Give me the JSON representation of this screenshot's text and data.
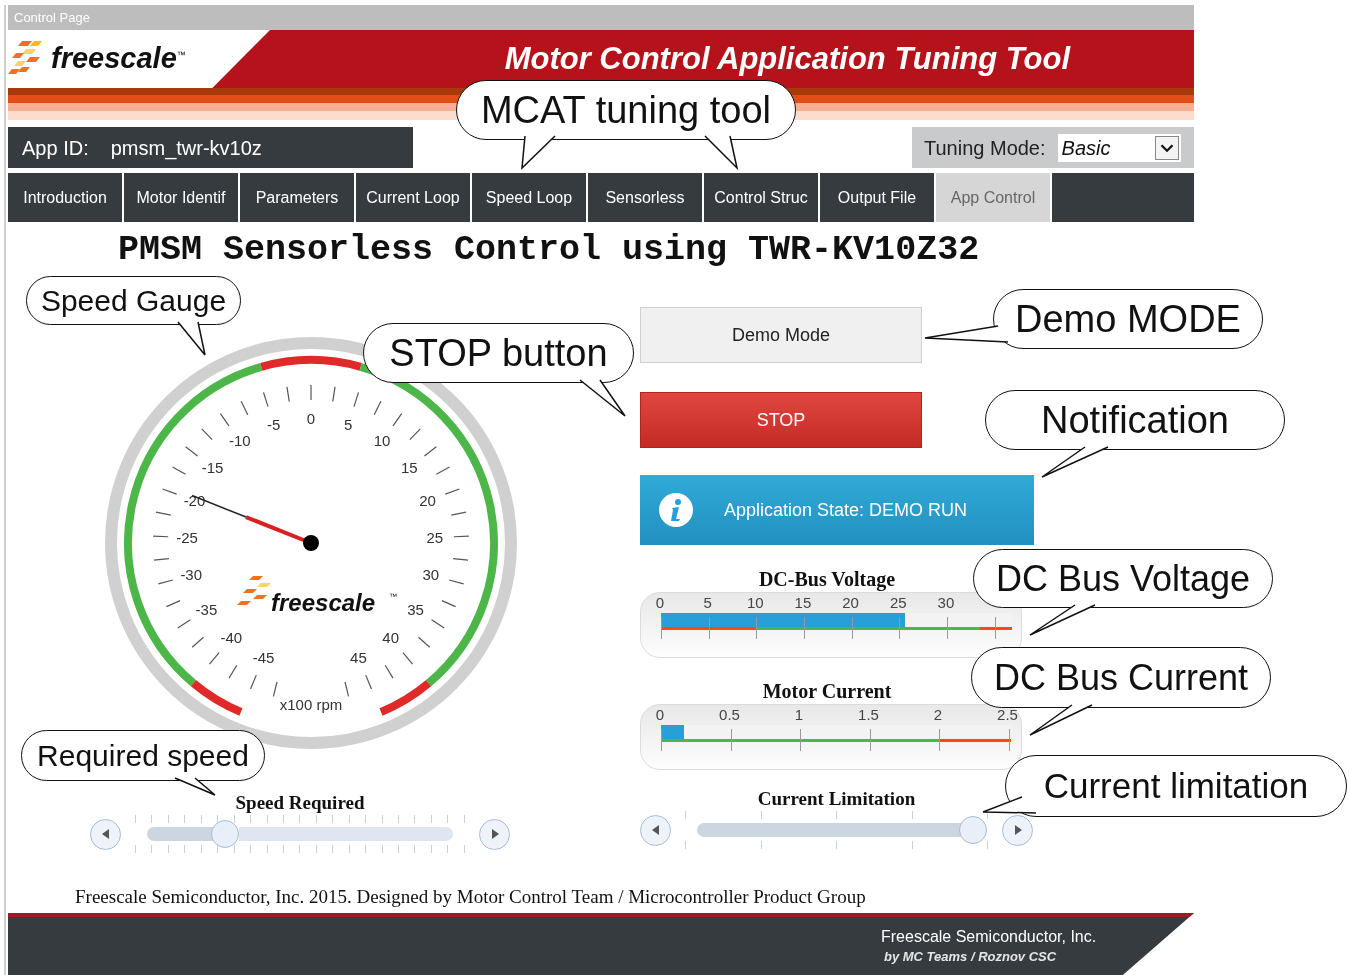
{
  "window": {
    "title": "Control Page"
  },
  "header": {
    "logo": "freescale",
    "trademark": "™",
    "title": "Motor Control Application Tuning Tool"
  },
  "app_id": {
    "label": "App ID:",
    "value": "pmsm_twr-kv10z"
  },
  "tuning_mode": {
    "label": "Tuning Mode:",
    "value": "Basic"
  },
  "tabs": [
    {
      "label": "Introduction",
      "selected": false
    },
    {
      "label": "Motor Identif",
      "selected": false
    },
    {
      "label": "Parameters",
      "selected": false
    },
    {
      "label": "Current Loop",
      "selected": false
    },
    {
      "label": "Speed Loop",
      "selected": false
    },
    {
      "label": "Sensorless",
      "selected": false
    },
    {
      "label": "Control Struc",
      "selected": false
    },
    {
      "label": "Output File",
      "selected": false
    },
    {
      "label": "App Control",
      "selected": true
    }
  ],
  "heading": "PMSM Sensorless Control using TWR-KV10Z32",
  "gauge": {
    "labels": [
      "-5",
      "0",
      "5",
      "-10",
      "10",
      "-15",
      "15",
      "-20",
      "20",
      "-25",
      "25",
      "-30",
      "30",
      "-35",
      "35",
      "-40",
      "40",
      "-45",
      "45"
    ],
    "unit": "x100 rpm",
    "logo": "freescale",
    "trademark": "™",
    "level": 0.305
  },
  "buttons": [
    {
      "label": "Demo Mode",
      "kind": "default"
    },
    {
      "label": "STOP",
      "kind": "danger"
    }
  ],
  "notification": {
    "text": "Application State: DEMO RUN"
  },
  "meters": [
    {
      "title": "DC-Bus Voltage",
      "labels": [
        "0",
        "5",
        "10",
        "15",
        "20",
        "25",
        "30"
      ],
      "level": 0.695
    },
    {
      "title": "Motor Current",
      "labels": [
        "0",
        "0.5",
        "1",
        "1.5",
        "2",
        "2.5"
      ],
      "level": 0.066
    }
  ],
  "sliders": [
    {
      "label": "Speed Required",
      "level": 0.255
    },
    {
      "label": "Current Limitation",
      "level": 0.99
    }
  ],
  "footer": {
    "note": "Freescale Semiconductor, Inc. 2015. Designed by Motor Control Team / Microcontroller Product Group",
    "company": "Freescale Semiconductor, Inc.",
    "credit": "by MC Teams / Roznov CSC"
  },
  "callouts": [
    {
      "text": "MCAT tuning tool"
    },
    {
      "text": "Speed Gauge"
    },
    {
      "text": "STOP button"
    },
    {
      "text": "Demo MODE"
    },
    {
      "text": "Notification"
    },
    {
      "text": "DC Bus Voltage"
    },
    {
      "text": "DC Bus Current"
    },
    {
      "text": "Required speed"
    },
    {
      "text": "Current limitation"
    }
  ]
}
